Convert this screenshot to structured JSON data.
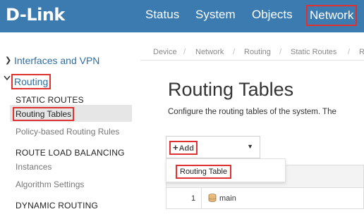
{
  "header": {
    "logo": "D-Link",
    "nav": [
      {
        "label": "Status"
      },
      {
        "label": "System"
      },
      {
        "label": "Objects"
      },
      {
        "label": "Network"
      }
    ]
  },
  "sidebar": {
    "interfaces_label": "Interfaces and VPN",
    "routing_label": "Routing",
    "sections": [
      {
        "heading": "STATIC ROUTES",
        "items": [
          "Routing Tables",
          "Policy-based Routing Rules"
        ]
      },
      {
        "heading": "ROUTE LOAD BALANCING",
        "items": [
          "Instances",
          "Algorithm Settings"
        ]
      },
      {
        "heading": "DYNAMIC ROUTING",
        "items": []
      }
    ]
  },
  "breadcrumb": [
    "Device",
    "Network",
    "Routing",
    "Static Routes",
    "R"
  ],
  "main": {
    "title": "Routing Tables",
    "description": "Configure the routing tables of the system. The",
    "add_label": "Add",
    "dropdown_item": "Routing Table",
    "table": {
      "rows": [
        {
          "index": "1",
          "name": "main"
        }
      ]
    }
  },
  "colors": {
    "header_bg": "#3b7bb0",
    "link": "#2d6ea3",
    "highlight_border": "#e03030"
  }
}
